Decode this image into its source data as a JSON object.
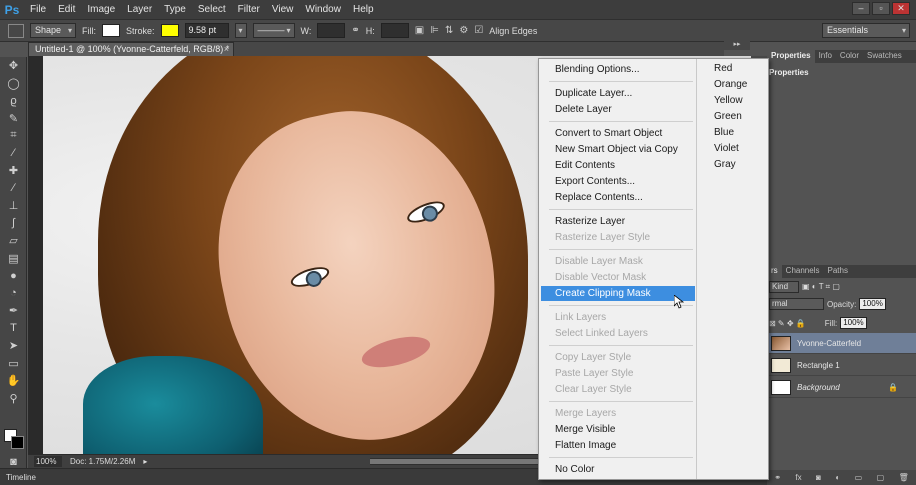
{
  "app": {
    "logo": "Ps",
    "menu": [
      "File",
      "Edit",
      "Image",
      "Layer",
      "Type",
      "Select",
      "Filter",
      "View",
      "Window",
      "Help"
    ],
    "window_controls": [
      "–",
      "▫",
      "✕"
    ]
  },
  "options_bar": {
    "mode": "Shape",
    "fill_label": "Fill:",
    "stroke_label": "Stroke:",
    "stroke_color": "#ffff00",
    "stroke_width": "9.58 pt",
    "w_label": "W:",
    "h_label": "H:",
    "align_edges_label": "Align Edges",
    "workspace": "Essentials"
  },
  "document": {
    "tab_title": "Untitled-1 @ 100% (Yvonne-Catterfeld, RGB/8) *",
    "tab_close": "×"
  },
  "status": {
    "zoom": "100%",
    "doc_info": "Doc: 1.75M/2.26M"
  },
  "timeline": {
    "label": "Timeline"
  },
  "properties_panel": {
    "tabs": [
      "Properties",
      "Info",
      "Color",
      "Swatches"
    ],
    "title": "Properties"
  },
  "layers_panel": {
    "tabs": [
      "rs",
      "Channels",
      "Paths"
    ],
    "kind_label": "Kind",
    "blend_mode": "rmal",
    "opacity_label": "Opacity:",
    "opacity": "100%",
    "fill_label": "Fill:",
    "fill": "100%",
    "layers": [
      {
        "name": "Yvonne-Catterfeld",
        "selected": true
      },
      {
        "name": "Rectangle 1",
        "selected": false
      },
      {
        "name": "Background",
        "selected": false
      }
    ]
  },
  "context_menu": {
    "items": [
      {
        "label": "Blending Options...",
        "enabled": true
      },
      {
        "label": "Duplicate Layer...",
        "enabled": true
      },
      {
        "label": "Delete Layer",
        "enabled": true
      },
      {
        "label": "Convert to Smart Object",
        "enabled": true
      },
      {
        "label": "New Smart Object via Copy",
        "enabled": true
      },
      {
        "label": "Edit Contents",
        "enabled": true
      },
      {
        "label": "Export Contents...",
        "enabled": true
      },
      {
        "label": "Replace Contents...",
        "enabled": true
      },
      {
        "label": "Rasterize Layer",
        "enabled": true
      },
      {
        "label": "Rasterize Layer Style",
        "enabled": false
      },
      {
        "label": "Disable Layer Mask",
        "enabled": false
      },
      {
        "label": "Disable Vector Mask",
        "enabled": false
      },
      {
        "label": "Create Clipping Mask",
        "enabled": true,
        "highlighted": true
      },
      {
        "label": "Link Layers",
        "enabled": false
      },
      {
        "label": "Select Linked Layers",
        "enabled": false
      },
      {
        "label": "Copy Layer Style",
        "enabled": false
      },
      {
        "label": "Paste Layer Style",
        "enabled": false
      },
      {
        "label": "Clear Layer Style",
        "enabled": false
      },
      {
        "label": "Merge Layers",
        "enabled": false
      },
      {
        "label": "Merge Visible",
        "enabled": true
      },
      {
        "label": "Flatten Image",
        "enabled": true
      },
      {
        "label": "No Color",
        "enabled": true
      }
    ],
    "colors": [
      "Red",
      "Orange",
      "Yellow",
      "Green",
      "Blue",
      "Violet",
      "Gray"
    ]
  }
}
